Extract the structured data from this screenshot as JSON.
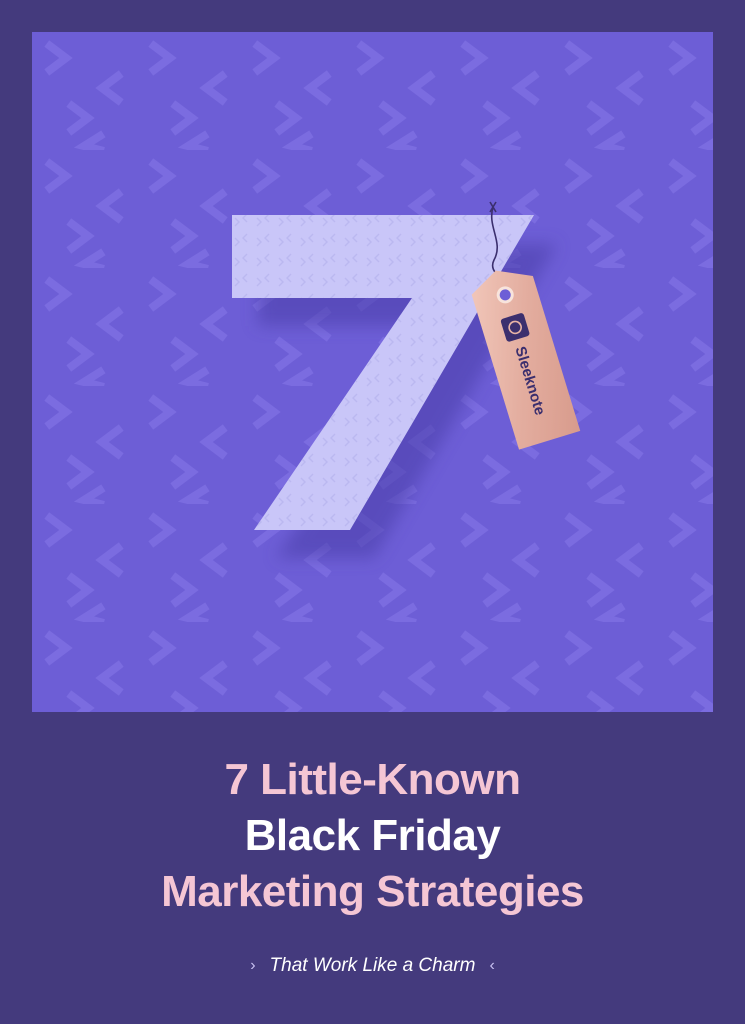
{
  "hero": {
    "number": "7",
    "tag_brand": "Sleeknote",
    "colors": {
      "frame": "#443a7d",
      "hero_bg": "#6d5ed6",
      "pattern": "#7b6ce0",
      "digit": "#c5c2f7",
      "tag": "#e8b4a6"
    }
  },
  "title": {
    "line1": "7 Little-Known",
    "line2": "Black Friday",
    "line3": "Marketing Strategies"
  },
  "tagline": {
    "text": "That Work Like a Charm",
    "left_icon": "chevron-right-icon",
    "right_icon": "chevron-left-icon"
  }
}
